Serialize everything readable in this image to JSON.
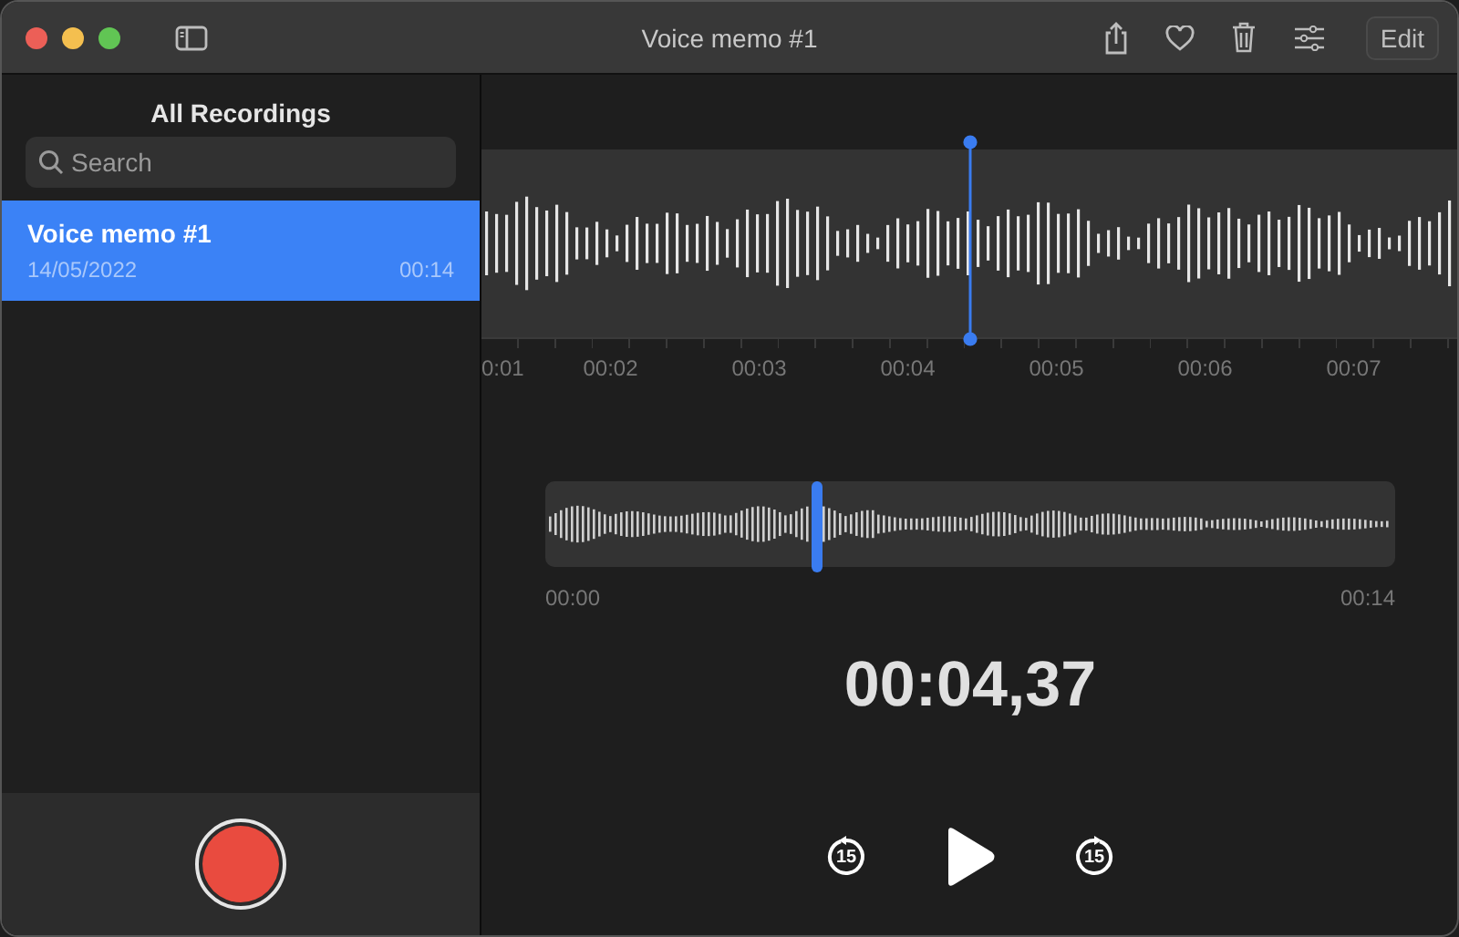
{
  "window": {
    "title": "Voice memo #1"
  },
  "toolbar": {
    "edit_button": "Edit"
  },
  "sidebar": {
    "heading": "All Recordings",
    "search": {
      "placeholder": "Search"
    },
    "items": [
      {
        "title": "Voice memo #1",
        "date": "14/05/2022",
        "duration": "00:14",
        "selected": true
      }
    ]
  },
  "timeline": {
    "labels": [
      "0:01",
      "00:02",
      "00:03",
      "00:04",
      "00:05",
      "00:06",
      "00:07"
    ]
  },
  "overview": {
    "level": 0.32,
    "start": "00:00",
    "end": "00:14"
  },
  "current_time": "00:04,37",
  "controls": {
    "skip_back": "15",
    "skip_forward": "15"
  }
}
